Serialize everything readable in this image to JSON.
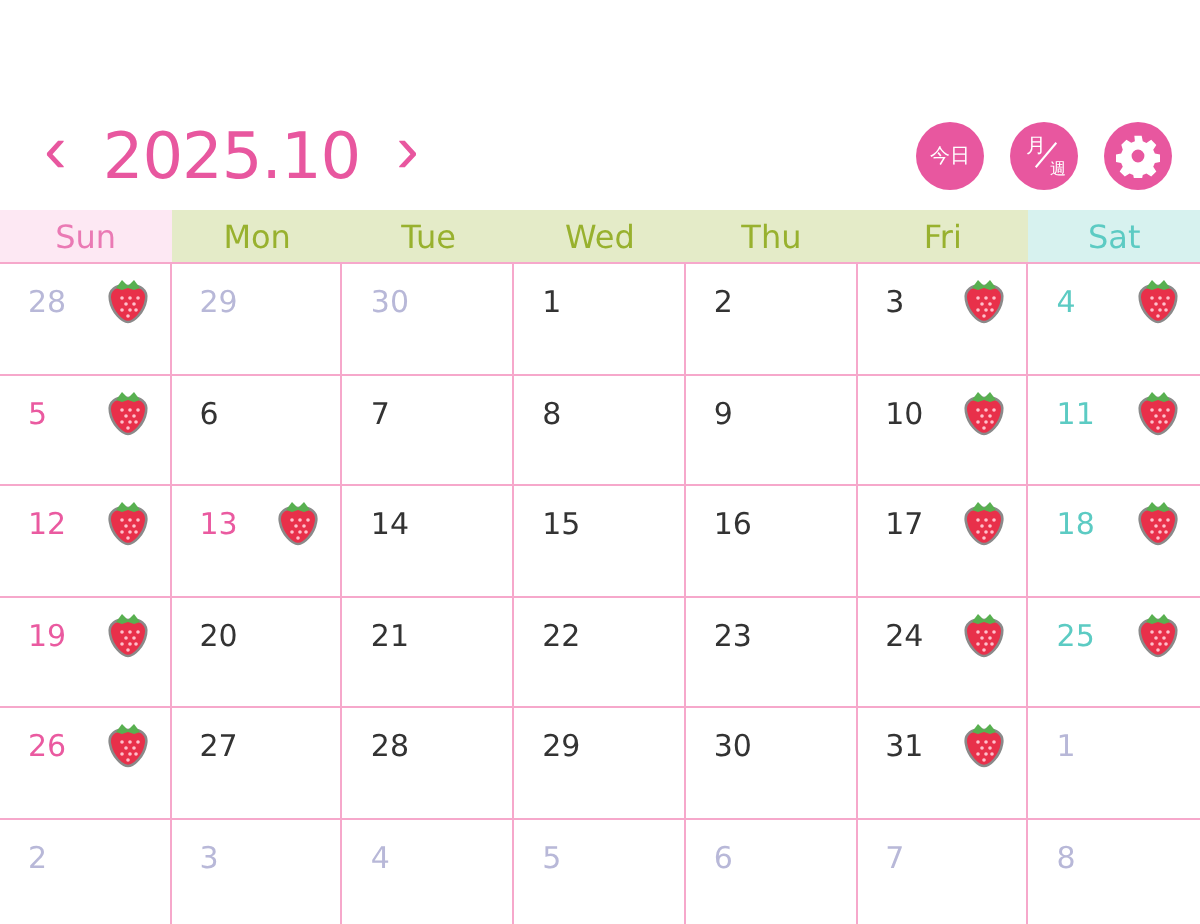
{
  "header": {
    "prev": "‹",
    "title": "2025.10",
    "next": "›",
    "today_button": "今日",
    "view_button": {
      "top": "月",
      "bottom": "週"
    }
  },
  "weekdays": [
    {
      "label": "Sun",
      "kind": "sun"
    },
    {
      "label": "Mon",
      "kind": "weekday"
    },
    {
      "label": "Tue",
      "kind": "weekday"
    },
    {
      "label": "Wed",
      "kind": "weekday"
    },
    {
      "label": "Thu",
      "kind": "weekday"
    },
    {
      "label": "Fri",
      "kind": "weekday"
    },
    {
      "label": "Sat",
      "kind": "sat"
    }
  ],
  "days": [
    {
      "day": "28",
      "kind": "other",
      "stamp": true
    },
    {
      "day": "29",
      "kind": "other",
      "stamp": false
    },
    {
      "day": "30",
      "kind": "other",
      "stamp": false
    },
    {
      "day": "1",
      "kind": "weekday",
      "stamp": false
    },
    {
      "day": "2",
      "kind": "weekday",
      "stamp": false
    },
    {
      "day": "3",
      "kind": "weekday",
      "stamp": true
    },
    {
      "day": "4",
      "kind": "sat",
      "stamp": true
    },
    {
      "day": "5",
      "kind": "sun",
      "stamp": true
    },
    {
      "day": "6",
      "kind": "weekday",
      "stamp": false
    },
    {
      "day": "7",
      "kind": "weekday",
      "stamp": false
    },
    {
      "day": "8",
      "kind": "weekday",
      "stamp": false
    },
    {
      "day": "9",
      "kind": "weekday",
      "stamp": false
    },
    {
      "day": "10",
      "kind": "weekday",
      "stamp": true
    },
    {
      "day": "11",
      "kind": "sat",
      "stamp": true
    },
    {
      "day": "12",
      "kind": "sun",
      "stamp": true
    },
    {
      "day": "13",
      "kind": "sun",
      "stamp": true
    },
    {
      "day": "14",
      "kind": "weekday",
      "stamp": false
    },
    {
      "day": "15",
      "kind": "weekday",
      "stamp": false
    },
    {
      "day": "16",
      "kind": "weekday",
      "stamp": false
    },
    {
      "day": "17",
      "kind": "weekday",
      "stamp": true
    },
    {
      "day": "18",
      "kind": "sat",
      "stamp": true
    },
    {
      "day": "19",
      "kind": "sun",
      "stamp": true
    },
    {
      "day": "20",
      "kind": "weekday",
      "stamp": false
    },
    {
      "day": "21",
      "kind": "weekday",
      "stamp": false
    },
    {
      "day": "22",
      "kind": "weekday",
      "stamp": false
    },
    {
      "day": "23",
      "kind": "weekday",
      "stamp": false
    },
    {
      "day": "24",
      "kind": "weekday",
      "stamp": true
    },
    {
      "day": "25",
      "kind": "sat",
      "stamp": true
    },
    {
      "day": "26",
      "kind": "sun",
      "stamp": true
    },
    {
      "day": "27",
      "kind": "weekday",
      "stamp": false
    },
    {
      "day": "28",
      "kind": "weekday",
      "stamp": false
    },
    {
      "day": "29",
      "kind": "weekday",
      "stamp": false
    },
    {
      "day": "30",
      "kind": "weekday",
      "stamp": false
    },
    {
      "day": "31",
      "kind": "weekday",
      "stamp": true
    },
    {
      "day": "1",
      "kind": "other",
      "stamp": false
    },
    {
      "day": "2",
      "kind": "other",
      "stamp": false
    },
    {
      "day": "3",
      "kind": "other",
      "stamp": false
    },
    {
      "day": "4",
      "kind": "other",
      "stamp": false
    },
    {
      "day": "5",
      "kind": "other",
      "stamp": false
    },
    {
      "day": "6",
      "kind": "other",
      "stamp": false
    },
    {
      "day": "7",
      "kind": "other",
      "stamp": false
    },
    {
      "day": "8",
      "kind": "other",
      "stamp": false
    }
  ]
}
